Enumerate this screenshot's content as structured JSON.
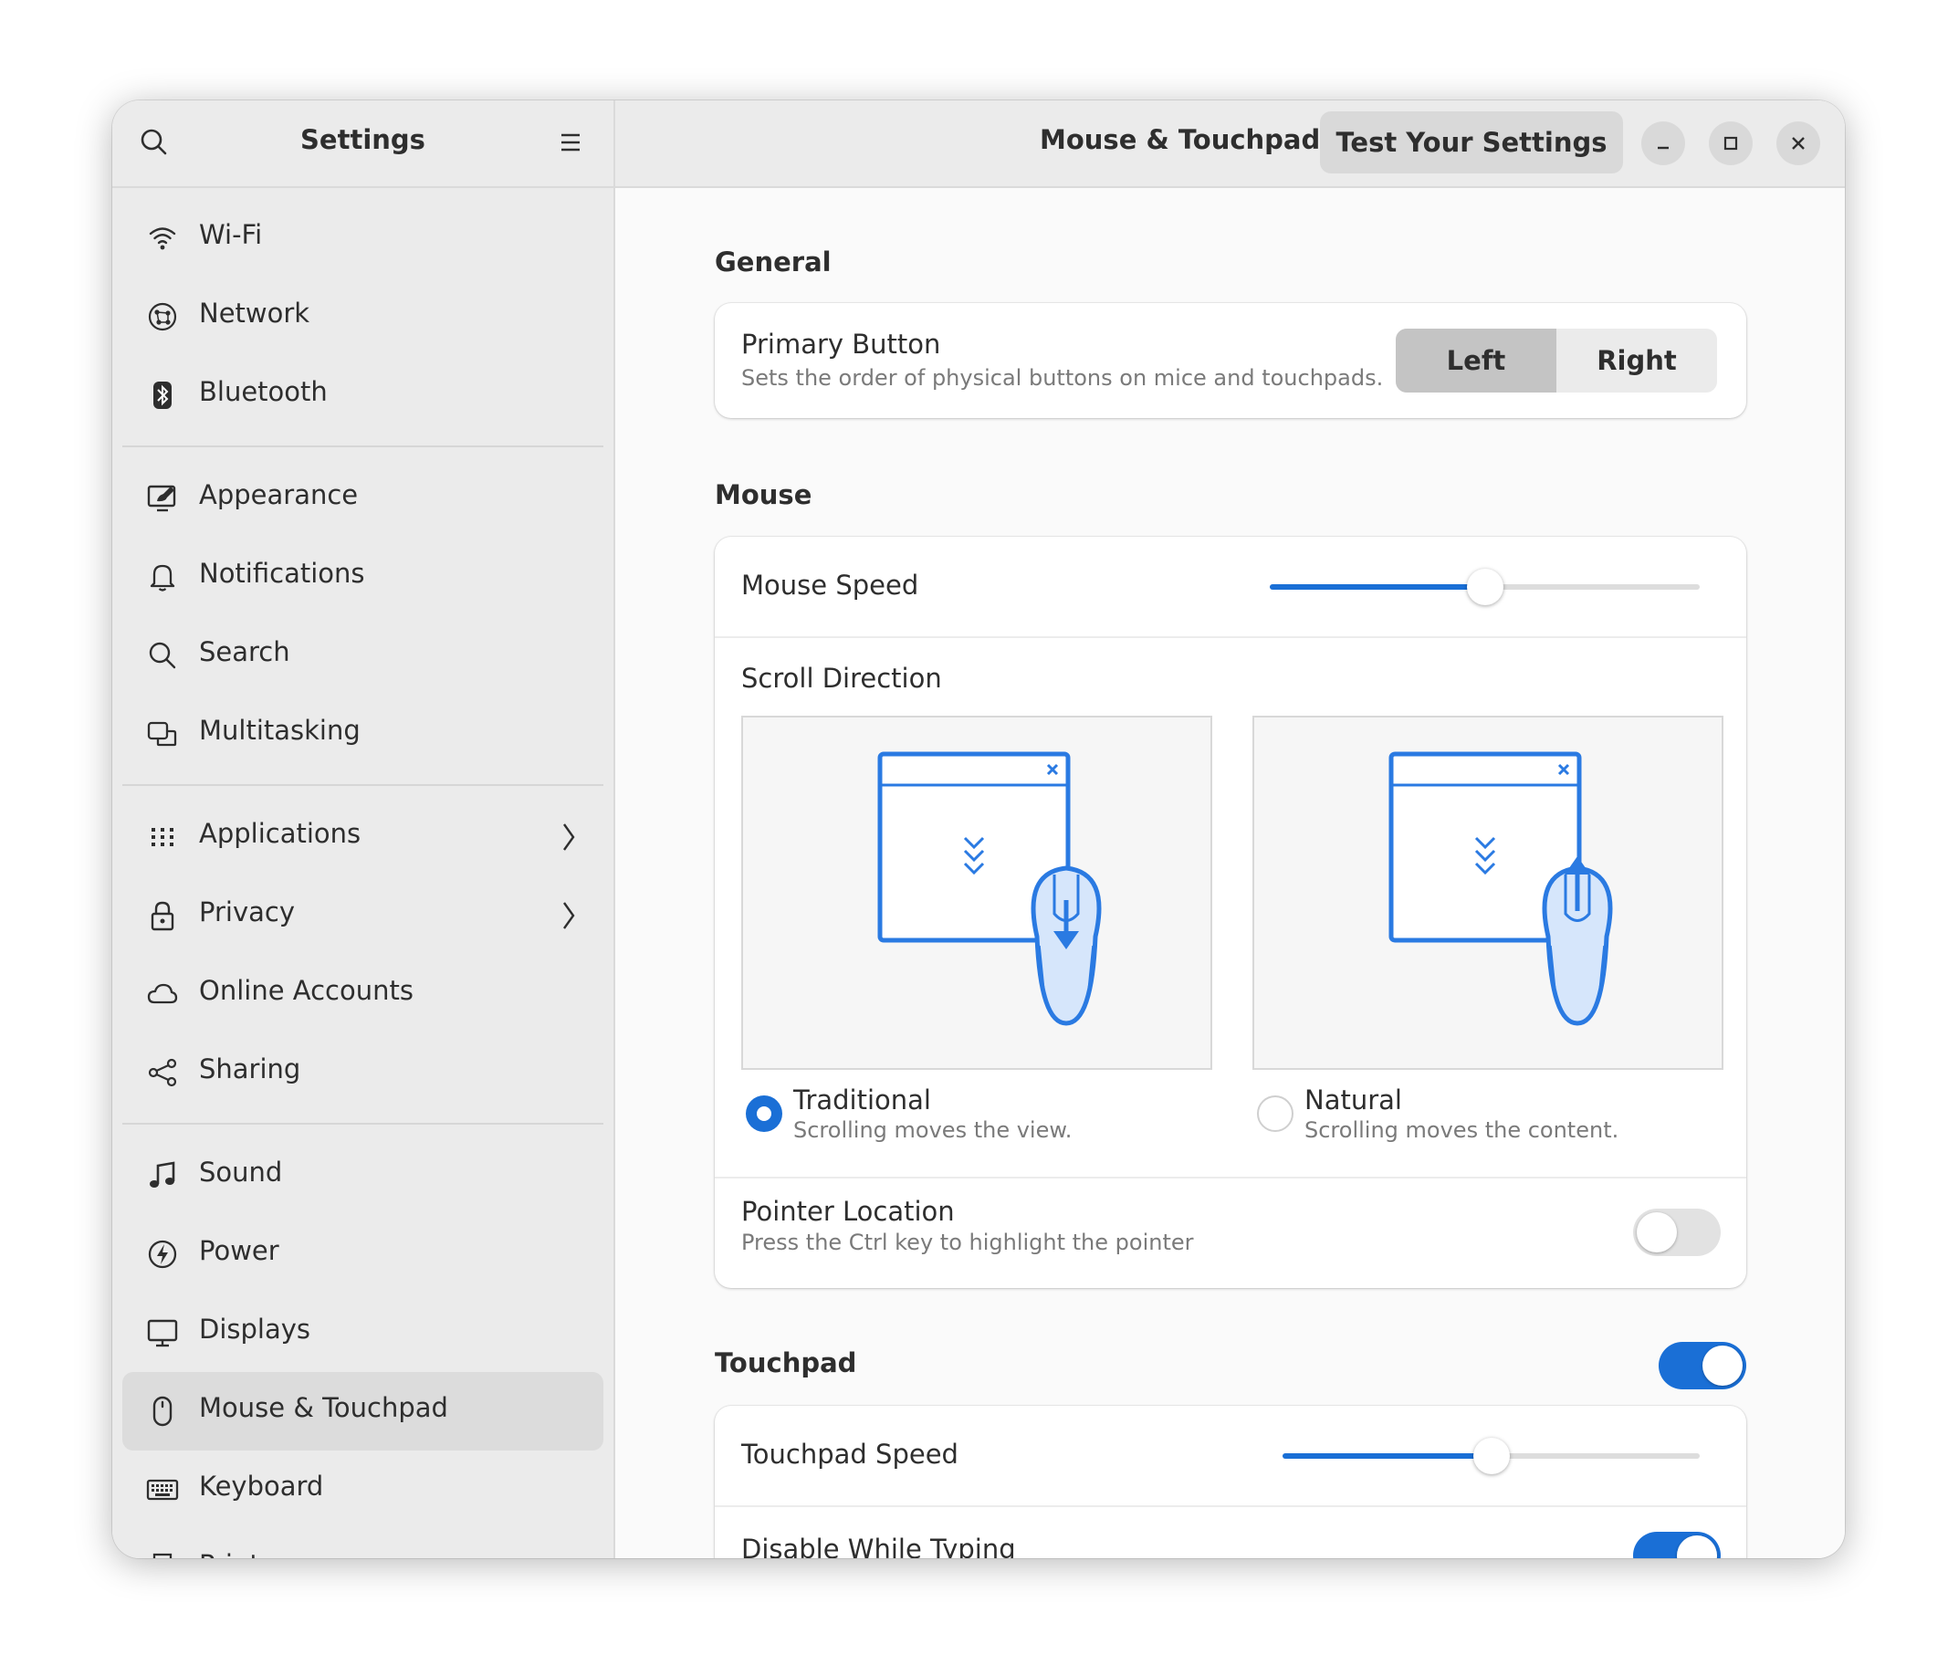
{
  "sidebar": {
    "title": "Settings",
    "search_icon": "search-icon",
    "menu_icon": "hamburger-menu-icon",
    "groups": [
      [
        {
          "label": "Wi-Fi",
          "icon": "wifi-icon"
        },
        {
          "label": "Network",
          "icon": "network-icon"
        },
        {
          "label": "Bluetooth",
          "icon": "bluetooth-icon"
        }
      ],
      [
        {
          "label": "Appearance",
          "icon": "appearance-icon"
        },
        {
          "label": "Notifications",
          "icon": "bell-icon"
        },
        {
          "label": "Search",
          "icon": "search-icon"
        },
        {
          "label": "Multitasking",
          "icon": "multitasking-icon"
        }
      ],
      [
        {
          "label": "Applications",
          "icon": "apps-grid-icon",
          "chevron": true
        },
        {
          "label": "Privacy",
          "icon": "lock-icon",
          "chevron": true
        },
        {
          "label": "Online Accounts",
          "icon": "cloud-icon"
        },
        {
          "label": "Sharing",
          "icon": "share-icon"
        }
      ],
      [
        {
          "label": "Sound",
          "icon": "music-note-icon"
        },
        {
          "label": "Power",
          "icon": "power-icon"
        },
        {
          "label": "Displays",
          "icon": "display-icon"
        },
        {
          "label": "Mouse & Touchpad",
          "icon": "mouse-icon",
          "selected": true
        },
        {
          "label": "Keyboard",
          "icon": "keyboard-icon"
        },
        {
          "label": "Printers",
          "icon": "printer-icon"
        }
      ]
    ]
  },
  "header": {
    "title": "Mouse & Touchpad",
    "test_button": "Test Your Settings",
    "window_controls": [
      "minimize-icon",
      "maximize-icon",
      "close-icon"
    ]
  },
  "general": {
    "title": "General",
    "primary_button": {
      "title": "Primary Button",
      "subtitle": "Sets the order of physical buttons on mice and touchpads.",
      "options": [
        "Left",
        "Right"
      ],
      "selected": "Left"
    }
  },
  "mouse": {
    "title": "Mouse",
    "speed_label": "Mouse Speed",
    "speed_value": 0.5,
    "scroll_direction": {
      "title": "Scroll Direction",
      "options": [
        {
          "label": "Traditional",
          "sub": "Scrolling moves the view.",
          "selected": true
        },
        {
          "label": "Natural",
          "sub": "Scrolling moves the content.",
          "selected": false
        }
      ]
    },
    "pointer_location": {
      "title": "Pointer Location",
      "subtitle": "Press the Ctrl key to highlight the pointer",
      "enabled": false
    }
  },
  "touchpad": {
    "title": "Touchpad",
    "enabled": true,
    "speed_label": "Touchpad Speed",
    "speed_value": 0.5,
    "disable_while_typing": {
      "label": "Disable While Typing",
      "enabled": true
    }
  },
  "colors": {
    "accent": "#1a6fd6"
  }
}
